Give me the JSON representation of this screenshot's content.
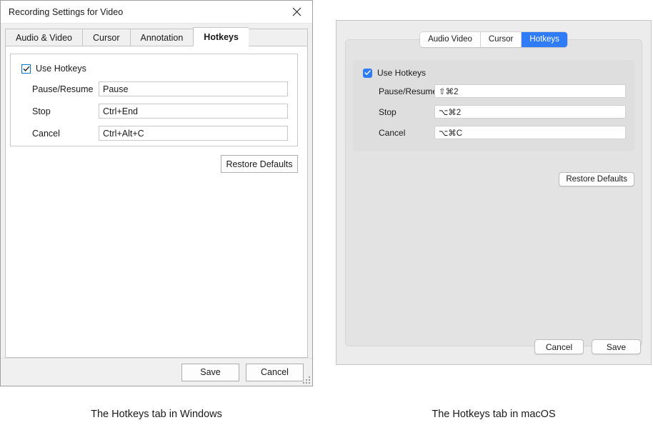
{
  "windows": {
    "title": "Recording Settings for Video",
    "close_icon": "close-icon",
    "tabs": [
      {
        "label": "Audio & Video",
        "active": false
      },
      {
        "label": "Cursor",
        "active": false
      },
      {
        "label": "Annotation",
        "active": false
      },
      {
        "label": "Hotkeys",
        "active": true
      }
    ],
    "checkbox": {
      "label": "Use Hotkeys",
      "checked": true,
      "icon": "checkmark-icon"
    },
    "fields": [
      {
        "label": "Pause/Resume",
        "value": "Pause"
      },
      {
        "label": "Stop",
        "value": "Ctrl+End"
      },
      {
        "label": "Cancel",
        "value": "Ctrl+Alt+C"
      }
    ],
    "restore_label": "Restore Defaults",
    "footer": {
      "save_label": "Save",
      "cancel_label": "Cancel"
    },
    "resize_grip": "resize-grip-icon"
  },
  "macos": {
    "tabs": [
      {
        "label": "Audio  Video",
        "active": false
      },
      {
        "label": "Cursor",
        "active": false
      },
      {
        "label": "Hotkeys",
        "active": true
      }
    ],
    "checkbox": {
      "label": "Use Hotkeys",
      "checked": true,
      "icon": "checkmark-icon"
    },
    "fields": [
      {
        "label": "Pause/Resume",
        "value": "⇧⌘2"
      },
      {
        "label": "Stop",
        "value": "⌥⌘2"
      },
      {
        "label": "Cancel",
        "value": "⌥⌘C"
      }
    ],
    "restore_label": "Restore Defaults",
    "footer": {
      "cancel_label": "Cancel",
      "save_label": "Save"
    }
  },
  "captions": {
    "windows": "The Hotkeys tab in Windows",
    "macos": "The Hotkeys tab in macOS"
  },
  "colors": {
    "accent_windows": "#0078d7",
    "accent_macos": "#2f7cf6",
    "window_bg": "#ffffff",
    "panel_bg": "#f0f0f0",
    "mac_bg": "#ececec"
  }
}
